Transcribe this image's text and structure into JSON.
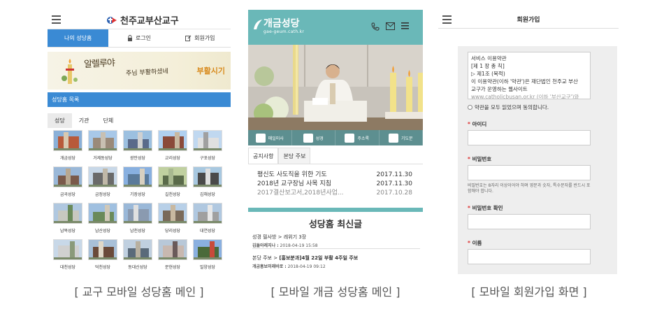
{
  "screen1": {
    "brand": "천주교부산교구",
    "tabs": [
      "나의 성당홈",
      "로그인",
      "회원가입"
    ],
    "banner_text": "부활시기",
    "banner_calligraphy": "알렐루야",
    "banner_calligraphy2": "주님 부활하셨네",
    "section_title": "성당홈 목록",
    "subtabs": [
      "성당",
      "기관",
      "단체"
    ],
    "parishes": [
      "개금성당",
      "거제동성당",
      "광안성당",
      "교리성당",
      "구포성당",
      "금곡성당",
      "금정성당",
      "기장성당",
      "길천성당",
      "김해성당",
      "남목성당",
      "남산성당",
      "남천성당",
      "당리성당",
      "대연성당",
      "대천성당",
      "덕천성당",
      "동대신성당",
      "문현성당",
      "밀양성당"
    ],
    "caption": "[ 교구 모바일 성당홈 메인 ]"
  },
  "screen2": {
    "title": "개금성당",
    "subtitle": "gae-geum.cath.kr",
    "quick": [
      "매일미사",
      "성경",
      "주소록",
      "기도문"
    ],
    "tabs": [
      "공지사항",
      "본당 주보"
    ],
    "notices": [
      {
        "title": "평신도 사도직을 위한 기도",
        "date": "2017.11.30"
      },
      {
        "title": "2018년 교구장님 사목 지침",
        "date": "2017.11.30"
      },
      {
        "title": "2017결산보고서,2018년사업...",
        "date": "2017.10.28"
      }
    ],
    "latest_title": "성당홈 최신글",
    "posts": [
      {
        "board": "성경 필사방 > ",
        "title": "레위기 3장",
        "author": "김돌아레지나 :",
        "time": " 2018-04-19 15:58"
      },
      {
        "board": "본당 주보 > ",
        "title": "[홍보분과]4월 22일 부활 4주일 주보",
        "author": "개금홍보미래바로 :",
        "time": " 2018-04-19 09:12"
      }
    ],
    "caption": "[ 모바일 개금 성당홈 메인 ]"
  },
  "screen3": {
    "title": "회원가입",
    "terms_lines": [
      "서비스 이용약관",
      "[제 1 장 총 칙]",
      "▷ 제1조 (목적)",
      "이 이용약관(이하 '약관')은 재단법인 천주교 부산",
      "교구가 운영하는 웹사이트",
      "www.catholicbusan.or.kr (이하 '부산교구')와"
    ],
    "agree_text": "약관을 모두 읽었으며 동의합니다.",
    "fields": [
      "아이디",
      "비밀번호",
      "비밀번호 확인",
      "이름"
    ],
    "password_help": "비밀번호는 8자리 이상이어야 하며 영문과 숫자, 특수문자를 반드시 포함해야 합니다.",
    "required_mark": "*",
    "caption": "[ 모바일 회원가입 화면 ]"
  },
  "colors": {
    "blue": "#3a8ad4",
    "teal": "#6ab8b8",
    "quickbar": "#5d8f90",
    "orange": "#d88a1d"
  }
}
